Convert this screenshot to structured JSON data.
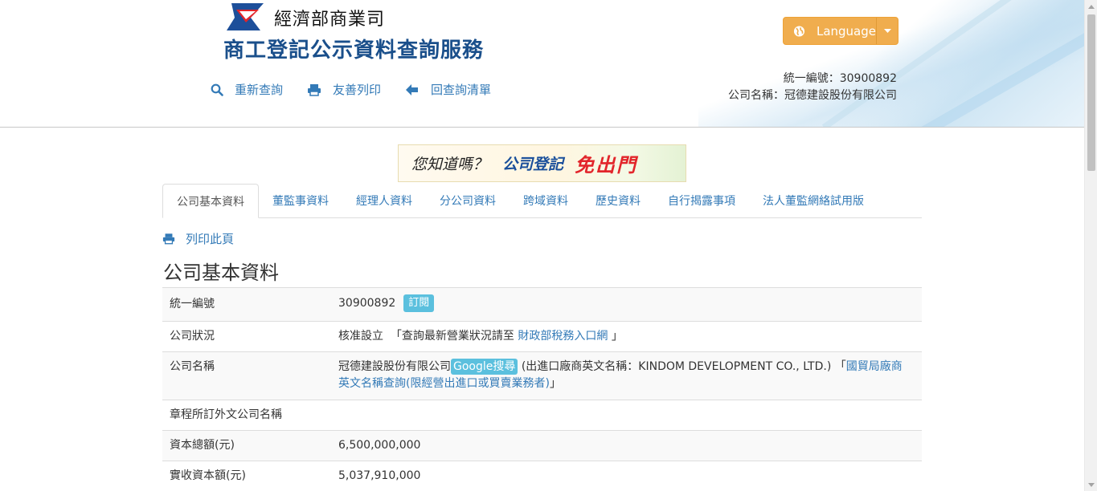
{
  "header": {
    "ministry": "經濟部商業司",
    "service_title": "商工登記公示資料查詢服務",
    "links": [
      {
        "label": "重新查詢",
        "icon": "search-icon"
      },
      {
        "label": "友善列印",
        "icon": "print-icon"
      },
      {
        "label": "回查詢清單",
        "icon": "arrow-left-icon"
      }
    ],
    "language_button": "Language",
    "ubn_line": "統一編號：30900892",
    "name_line": "公司名稱：冠德建設股份有限公司"
  },
  "banner": {
    "part1": "您知道嗎？",
    "part2": "公司登記",
    "part3": "免出門"
  },
  "tabs": [
    "公司基本資料",
    "董監事資料",
    "經理人資料",
    "分公司資料",
    "跨域資料",
    "歷史資料",
    "自行揭露事項",
    "法人董監網絡試用版"
  ],
  "print_page": "列印此頁",
  "page_title": "公司基本資料",
  "rows": {
    "ubn": {
      "label": "統一編號",
      "value": "30900892",
      "badge": "訂閱"
    },
    "status": {
      "label": "公司狀況",
      "value": "核准設立",
      "note_prefix": "「查詢最新營業狀況請至",
      "note_link": "財政部稅務入口網",
      "note_suffix": "」"
    },
    "name": {
      "label": "公司名稱",
      "value": "冠德建設股份有限公司",
      "badge": "Google搜尋",
      "en_note": "(出進口廠商英文名稱：KINDOM DEVELOPMENT CO., LTD.)",
      "bracket_open": "「",
      "link": "國貿局廠商英文名稱查詢(限經營出進口或買賣業務者)",
      "bracket_close": "」"
    },
    "foreign_name": {
      "label": "章程所訂外文公司名稱",
      "value": ""
    },
    "capital_total": {
      "label": "資本總額(元)",
      "value": "6,500,000,000"
    },
    "capital_paid": {
      "label": "實收資本額(元)",
      "value": "5,037,910,000"
    }
  },
  "colors": {
    "accent": "#337ab7",
    "warning": "#f0ad4e",
    "info": "#5bc0de",
    "title_blue": "#1a4f8b",
    "banner_red": "#e2252b"
  }
}
